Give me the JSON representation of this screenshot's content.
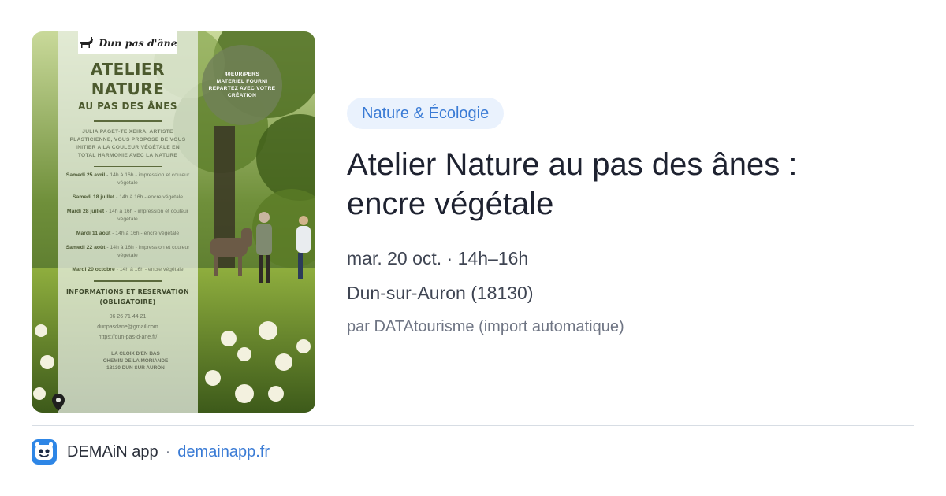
{
  "poster": {
    "brand": "Dun pas d'âne",
    "title_line1": "ATELIER",
    "title_line2": "NATURE",
    "subtitle": "AU PAS DES ÂNES",
    "intro": "JULIA PAGET-TEIXEIRA, ARTISTE PLASTICIENNE, VOUS PROPOSE DE VOUS INITIER A LA COULEUR VÉGÉTALE EN TOTAL HARMONIE AVEC LA NATURE",
    "dates": [
      {
        "day": "Samedi 25 avril",
        "rest": "- 14h à 16h - impression et couleur végétale"
      },
      {
        "day": "Samedi 18 juillet",
        "rest": "- 14h à 16h - encre végétale"
      },
      {
        "day": "Mardi 28 juillet",
        "rest": "- 14h à 16h - impression et couleur végétale"
      },
      {
        "day": "Mardi 11 août",
        "rest": "- 14h à 16h - encre végétale"
      },
      {
        "day": "Samedi 22 août",
        "rest": "- 14h à 16h - impression et couleur végétale"
      },
      {
        "day": "Mardi 20 octobre",
        "rest": "- 14h à 16h - encre végétale"
      }
    ],
    "info_heading": "INFORMATIONS ET RESERVATION (OBLIGATOIRE)",
    "phone": "06 26 71 44 21",
    "email": "dunpasdane@gmail.com",
    "website": "https://dun-pas-d-ane.fr/",
    "address_line1": "LA CLOIX D'EN BAS",
    "address_line2": "CHEMIN DE LA MORIANDE",
    "address_line3": "18130 DUN SUR AURON",
    "badge_line1": "40EUR/PERS",
    "badge_line2": "MATERIEL FOURNI",
    "badge_line3": "REPARTEZ AVEC VOTRE",
    "badge_line4": "CRÉATION"
  },
  "event": {
    "category": "Nature & Écologie",
    "title_line1": "Atelier Nature au pas des ânes :",
    "title_line2": "encre végétale",
    "datetime": "mar. 20 oct. · 14h–16h",
    "location": "Dun-sur-Auron (18130)",
    "source": "par DATAtourisme (import automatique)"
  },
  "footer": {
    "app_name": "DEMAiN app",
    "separator": "·",
    "link": "demainapp.fr"
  },
  "colors": {
    "accent": "#3a7bd5",
    "chip_bg": "#eaf2fd",
    "title": "#1e2230",
    "muted": "#6f7584"
  },
  "icons": [
    "donkey-logo-icon",
    "location-pin-icon",
    "demain-app-icon"
  ]
}
